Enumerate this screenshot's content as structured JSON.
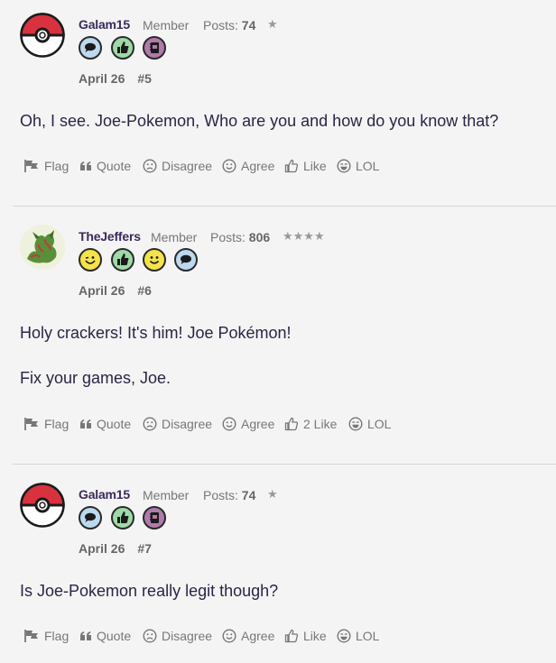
{
  "posts": [
    {
      "username": "Galam15",
      "role": "Member",
      "posts_label": "Posts:",
      "posts_count": "74",
      "stars": "★",
      "badges": [
        "speech-bubble-icon",
        "thumbs-up-icon",
        "notebook-icon"
      ],
      "date": "April 26",
      "number": "#5",
      "body": [
        "Oh, I see. Joe-Pokemon, Who are you and how do you know that?"
      ],
      "actions": {
        "flag": "Flag",
        "quote": "Quote",
        "disagree": "Disagree",
        "agree": "Agree",
        "like": "Like",
        "lol": "LOL"
      }
    },
    {
      "username": "TheJeffers",
      "role": "Member",
      "posts_label": "Posts:",
      "posts_count": "806",
      "stars": "★★★★",
      "badges": [
        "winking-face-icon",
        "thumbs-up-icon",
        "smiley-face-icon",
        "speech-bubble-icon"
      ],
      "date": "April 26",
      "number": "#6",
      "body": [
        "Holy crackers! It's him! Joe Pokémon!",
        "Fix your games, Joe."
      ],
      "actions": {
        "flag": "Flag",
        "quote": "Quote",
        "disagree": "Disagree",
        "agree": "Agree",
        "like": "2 Like",
        "lol": "LOL"
      }
    },
    {
      "username": "Galam15",
      "role": "Member",
      "posts_label": "Posts:",
      "posts_count": "74",
      "stars": "★",
      "badges": [
        "speech-bubble-icon",
        "thumbs-up-icon",
        "notebook-icon"
      ],
      "date": "April 26",
      "number": "#7",
      "body": [
        "Is Joe-Pokemon really legit though?"
      ],
      "actions": {
        "flag": "Flag",
        "quote": "Quote",
        "disagree": "Disagree",
        "agree": "Agree",
        "like": "Like",
        "lol": "LOL"
      }
    }
  ],
  "colors": {
    "badge_blue": "#bcd9ee",
    "badge_green": "#9fd9a7",
    "badge_purple": "#b07aa9",
    "badge_yellow": "#f4e34a",
    "pokeball_red": "#d9323f"
  }
}
